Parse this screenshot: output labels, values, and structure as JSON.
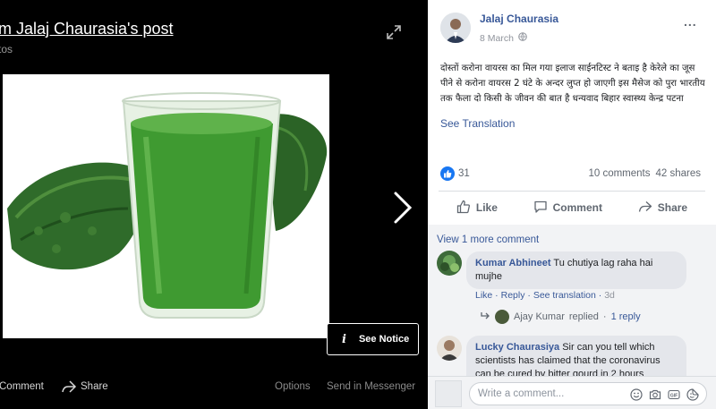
{
  "viewer": {
    "title": "m Jalaj Chaurasia's post",
    "subtitle": "tos",
    "see_notice_label": "See Notice",
    "actions": {
      "comment": "Comment",
      "share": "Share",
      "options": "Options",
      "send_in_messenger": "Send in Messenger"
    }
  },
  "post": {
    "author": "Jalaj Chaurasia",
    "date": "8 March",
    "text": "दोस्तों करोना वायरस का मिल गया इलाज साईनटिस्ट ने बताइ है केरेले का जूस पीने से करोना वायरस 2 घंटे के अन्दर लुप्त हो जाएगी इस मैसेज को पुरा भारतीय तक फैला दो किसी के जीवन की बात है धन्यवाद बिहार स्वास्थ्य केन्द्र पटना",
    "see_translation": "See Translation",
    "reaction_count": "31",
    "comments_count": "10 comments",
    "shares_count": "42 shares",
    "more_icon": "..."
  },
  "actions": {
    "like": "Like",
    "comment": "Comment",
    "share": "Share"
  },
  "comments": {
    "view_more": "View 1 more comment",
    "items": [
      {
        "name": "Kumar Abhineet",
        "text": "Tu chutiya lag raha hai mujhe",
        "links": {
          "like": "Like",
          "reply": "Reply",
          "see_translation": "See translation",
          "time": "3d"
        },
        "reply": {
          "author": "Ajay Kumar",
          "verb": "replied",
          "count": "1 reply"
        }
      },
      {
        "name": "Lucky Chaurasiya",
        "text": "Sir can you tell which scientists has claimed that the coronavirus can be cured by bitter gourd in 2 hours"
      }
    ]
  },
  "composer": {
    "placeholder": "Write a comment...",
    "gif_label": "GIF"
  },
  "colors": {
    "link": "#385898",
    "like_blue": "#1877f2",
    "viewer_bg": "#000000",
    "comment_bg": "#e4e6eb"
  }
}
